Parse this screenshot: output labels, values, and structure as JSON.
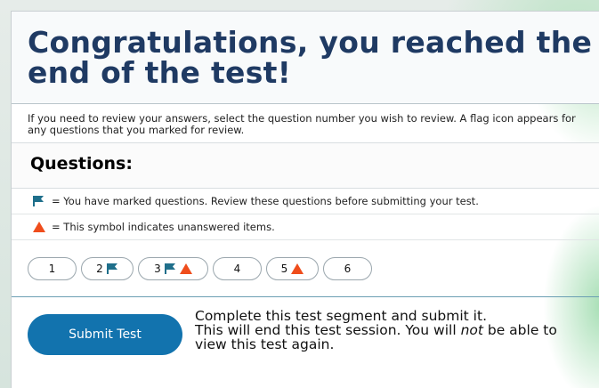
{
  "page": {
    "title": "Congratulations, you reached the end of the test!",
    "instructions": "If you need to review your answers, select the question number you wish to review. A flag icon appears for any questions that you marked for review."
  },
  "questions": {
    "heading": "Questions:",
    "legend": [
      {
        "icon": "flag-icon",
        "text": "= You have marked questions. Review these questions before submitting your test."
      },
      {
        "icon": "warning-triangle-icon",
        "text": "= This symbol indicates unanswered items."
      }
    ],
    "items": [
      {
        "number": "1",
        "flagged": false,
        "unanswered": false
      },
      {
        "number": "2",
        "flagged": true,
        "unanswered": false
      },
      {
        "number": "3",
        "flagged": true,
        "unanswered": true
      },
      {
        "number": "4",
        "flagged": false,
        "unanswered": false
      },
      {
        "number": "5",
        "flagged": false,
        "unanswered": true
      },
      {
        "number": "6",
        "flagged": false,
        "unanswered": false
      }
    ]
  },
  "submit": {
    "button_label": "Submit Test",
    "line1": "Complete this test segment and submit it.",
    "line2_before": "This will end this test session. You will ",
    "line2_emphasis": "not",
    "line2_after": " be able to view this test again."
  },
  "colors": {
    "title": "#1f3a63",
    "flag": "#1f6f8b",
    "warning": "#ef4d1c",
    "button": "#1273ae"
  }
}
